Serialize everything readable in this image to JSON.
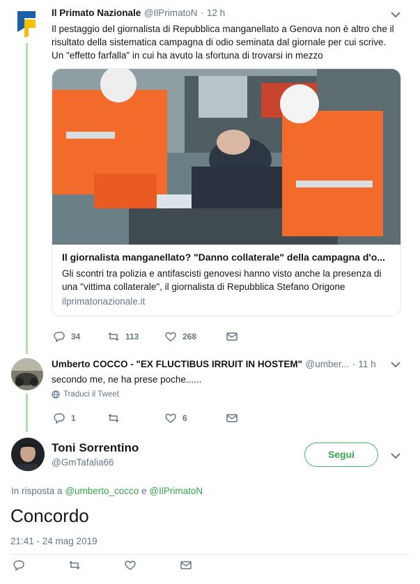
{
  "tweet1": {
    "name": "Il Primato Nazionale",
    "handle": "@IlPrimatoN",
    "time": "12 h",
    "text": "Il pestaggio del giornalista di Repubblica manganellato a Genova non è altro che il risultato della sistematica campagna di odio seminata dal giornale per cui scrive. Un \"effetto farfalla\" in cui ha avuto la sfortuna di trovarsi in mezzo",
    "card": {
      "title": "Il giornalista manganellato? \"Danno collaterale\" della campagna d'o...",
      "description": "Gli scontri tra polizia e antifascisti genovesi hanno visto anche la presenza di una \"vittima collaterale\", il giornalista di Repubblica Stefano Origone",
      "domain": "ilprimatonazionale.it"
    },
    "actions": {
      "replies": "34",
      "retweets": "113",
      "likes": "268"
    }
  },
  "tweet2": {
    "name": "Umberto COCCO - \"EX FLUCTIBUS IRRUIT IN HOSTEM\"",
    "handle": "@umber...",
    "time": "11 h",
    "text": "secondo me, ne ha prese poche......",
    "translate": "Traduci il Tweet",
    "actions": {
      "replies": "1",
      "retweets": "",
      "likes": "6"
    }
  },
  "tweet3": {
    "name": "Toni Sorrentino",
    "handle": "@GmTafalia66",
    "follow_label": "Segui",
    "reply_prefix": "In risposta a",
    "reply_user1": "@umberto_cocco",
    "reply_and": "e",
    "reply_user2": "@IlPrimatoN",
    "text": "Concordo",
    "timestamp": "21:41 - 24 mag 2019"
  },
  "colors": {
    "accent_green": "#37a34c",
    "thread_line": "#aee0b0",
    "muted_text": "#657786"
  },
  "icons": [
    "reply-icon",
    "retweet-icon",
    "like-icon",
    "dm-icon",
    "chevron-down-icon",
    "globe-icon"
  ]
}
